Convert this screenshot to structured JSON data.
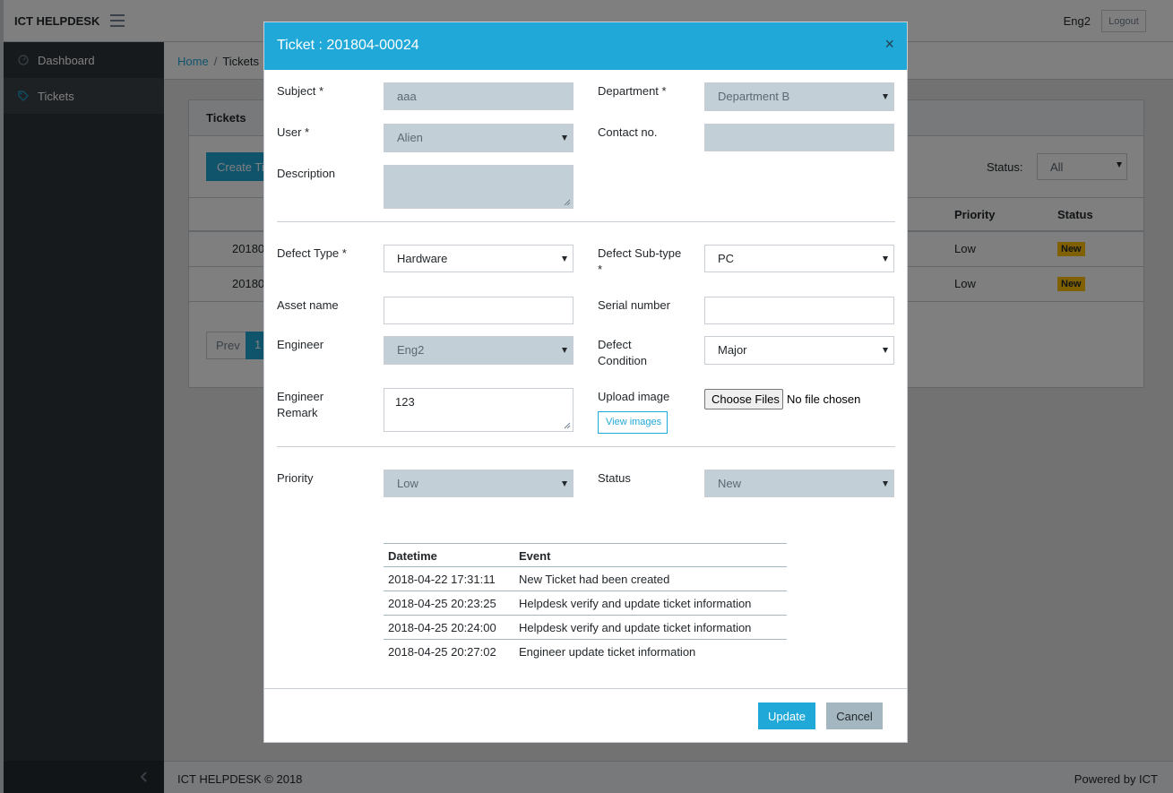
{
  "app": {
    "brand": "ICT HELPDESK",
    "user": "Eng2",
    "logout_label": "Logout"
  },
  "sidebar": {
    "items": [
      {
        "label": "Dashboard",
        "icon": "speedometer-icon"
      },
      {
        "label": "Tickets",
        "icon": "tag-icon"
      }
    ]
  },
  "breadcrumb": {
    "home": "Home",
    "current": "Tickets"
  },
  "tickets_card": {
    "title": "Tickets",
    "create_label": "Create Ti",
    "status_filter_label": "Status:",
    "status_filter_value": "All",
    "columns": {
      "priority": "Priority",
      "status": "Status"
    },
    "rows": [
      {
        "id_partial": "20180",
        "priority": "Low",
        "status": "New"
      },
      {
        "id_partial": "20180",
        "priority": "Low",
        "status": "New"
      }
    ],
    "pager": {
      "prev": "Prev",
      "page": "1"
    }
  },
  "footer": {
    "left": "ICT HELPDESK © 2018",
    "right": "Powered by ICT"
  },
  "modal": {
    "title": "Ticket : 201804-00024",
    "close": "×",
    "fields": {
      "subject": {
        "label": "Subject *",
        "value": "aaa"
      },
      "department": {
        "label": "Department *",
        "value": "Department B"
      },
      "user": {
        "label": "User *",
        "value": "Alien"
      },
      "contact": {
        "label": "Contact no.",
        "value": ""
      },
      "description": {
        "label": "Description",
        "value": ""
      },
      "defect_type": {
        "label": "Defect Type *",
        "value": "Hardware"
      },
      "defect_subtype": {
        "label": "Defect Sub-type *",
        "value": "PC"
      },
      "asset_name": {
        "label": "Asset name",
        "value": ""
      },
      "serial_number": {
        "label": "Serial number",
        "value": ""
      },
      "engineer": {
        "label": "Engineer",
        "value": "Eng2"
      },
      "defect_condition": {
        "label": "Defect Condition",
        "value": "Major"
      },
      "engineer_remark": {
        "label": "Engineer Remark",
        "value": "123"
      },
      "upload_image": {
        "label": "Upload image",
        "choose_label": "Choose Files",
        "no_file": "No file chosen",
        "view_label": "View images"
      },
      "priority": {
        "label": "Priority",
        "value": "Low"
      },
      "status": {
        "label": "Status",
        "value": "New"
      }
    },
    "log": {
      "headers": {
        "datetime": "Datetime",
        "event": "Event"
      },
      "rows": [
        {
          "datetime": "2018-04-22 17:31:11",
          "event": "New Ticket had been created"
        },
        {
          "datetime": "2018-04-25 20:23:25",
          "event": "Helpdesk verify and update ticket information"
        },
        {
          "datetime": "2018-04-25 20:24:00",
          "event": "Helpdesk verify and update ticket information"
        },
        {
          "datetime": "2018-04-25 20:27:02",
          "event": "Engineer update ticket information"
        }
      ]
    },
    "buttons": {
      "update": "Update",
      "cancel": "Cancel"
    }
  },
  "colors": {
    "primary": "#20a8d8",
    "warning": "#ffc107",
    "sidebar": "#2f353a",
    "readonly": "#c2cfd6",
    "secondary": "#a4b7c1"
  }
}
